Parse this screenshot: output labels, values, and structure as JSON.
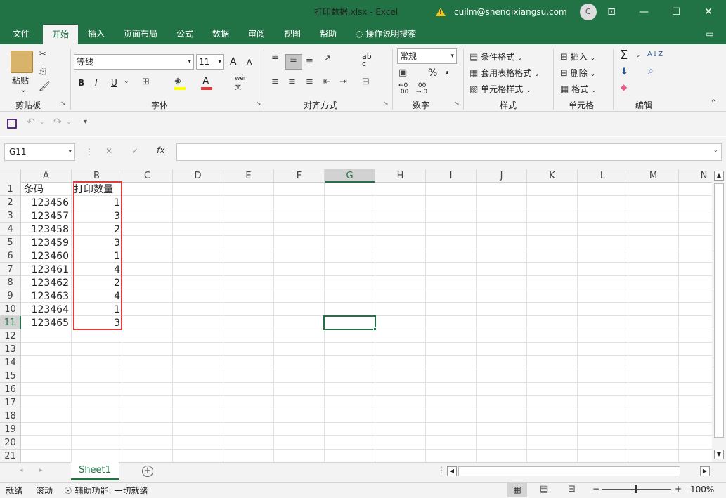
{
  "window": {
    "title": "打印数据.xlsx  -  Excel",
    "user_email": "cuilm@shenqixiangsu.com",
    "avatar_initial": "C",
    "min_glyph": "—",
    "max_glyph": "☐",
    "close_glyph": "✕",
    "restore_glyph": "⊡"
  },
  "tabs": [
    "文件",
    "开始",
    "插入",
    "页面布局",
    "公式",
    "数据",
    "审阅",
    "视图",
    "帮助"
  ],
  "tell_me": "操作说明搜索",
  "ribbon": {
    "clipboard": {
      "paste": "粘贴",
      "label": "剪贴板"
    },
    "font": {
      "name": "等线",
      "size": "11",
      "bold": "B",
      "italic": "I",
      "underline": "U",
      "grow": "A",
      "shrink": "A",
      "wen": "wén",
      "wen2": "文",
      "label": "字体"
    },
    "align": {
      "label": "对齐方式",
      "wrap1": "ab",
      "wrap2": "c"
    },
    "number": {
      "format": "常规",
      "percent": "%",
      "comma": ",",
      "inc1": "←0",
      "inc2": ".00",
      "dec1": ".00",
      "dec2": "→.0",
      "label": "数字"
    },
    "styles": {
      "cond": "条件格式",
      "table": "套用表格格式",
      "cell": "单元格样式",
      "label": "样式"
    },
    "cells": {
      "insert": "插入",
      "delete": "删除",
      "format": "格式",
      "label": "单元格"
    },
    "editing": {
      "label": "编辑",
      "sum": "Σ",
      "sort": "A↓Z",
      "find": "⌕"
    }
  },
  "formula_bar": {
    "name_box": "G11",
    "fx": "fx",
    "cancel": "✕",
    "enter": "✓",
    "value": ""
  },
  "columns": [
    "A",
    "B",
    "C",
    "D",
    "E",
    "F",
    "G",
    "H",
    "I",
    "J",
    "K",
    "L",
    "M",
    "N"
  ],
  "rows": [
    "1",
    "2",
    "3",
    "4",
    "5",
    "6",
    "7",
    "8",
    "9",
    "10",
    "11",
    "12",
    "13",
    "14",
    "15",
    "16",
    "17",
    "18",
    "19",
    "20",
    "21"
  ],
  "cells": {
    "header": {
      "A": "条码",
      "B": "打印数量"
    },
    "data": [
      {
        "A": "123456",
        "B": "1"
      },
      {
        "A": "123457",
        "B": "3"
      },
      {
        "A": "123458",
        "B": "2"
      },
      {
        "A": "123459",
        "B": "3"
      },
      {
        "A": "123460",
        "B": "1"
      },
      {
        "A": "123461",
        "B": "4"
      },
      {
        "A": "123462",
        "B": "2"
      },
      {
        "A": "123463",
        "B": "4"
      },
      {
        "A": "123464",
        "B": "1"
      },
      {
        "A": "123465",
        "B": "3"
      }
    ]
  },
  "sheet_tabs": [
    "Sheet1"
  ],
  "status": {
    "ready": "就绪",
    "scroll": "滚动",
    "accessibility": "辅助功能: 一切就绪",
    "zoom": "100%",
    "minus": "−",
    "plus": "+"
  },
  "colors": {
    "accent": "#217346",
    "highlight": "#e03c3c"
  }
}
